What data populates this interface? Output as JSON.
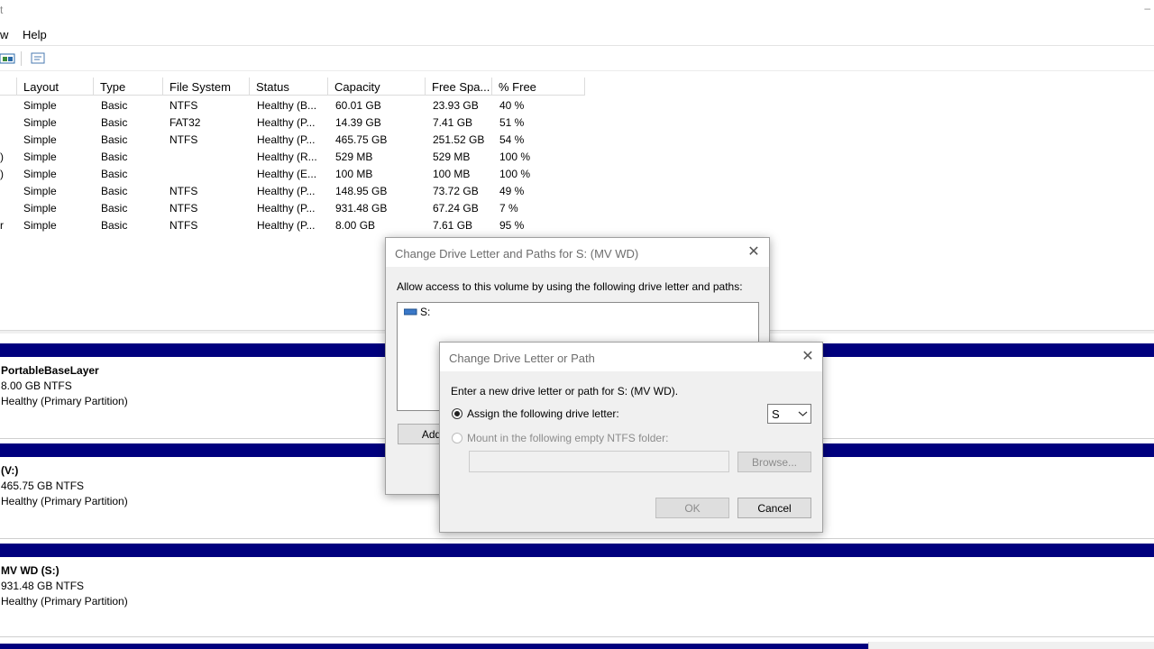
{
  "window": {
    "title_fragment": "t",
    "minimize_glyph": "–"
  },
  "menu": {
    "view_fragment": "w",
    "help": "Help"
  },
  "columns": [
    "Layout",
    "Type",
    "File System",
    "Status",
    "Capacity",
    "Free Spa...",
    "% Free"
  ],
  "volumes": [
    {
      "prefix": "",
      "layout": "Simple",
      "type": "Basic",
      "fs": "NTFS",
      "status": "Healthy (B...",
      "capacity": "60.01 GB",
      "free": "23.93 GB",
      "pct": "40 %"
    },
    {
      "prefix": "",
      "layout": "Simple",
      "type": "Basic",
      "fs": "FAT32",
      "status": "Healthy (P...",
      "capacity": "14.39 GB",
      "free": "7.41 GB",
      "pct": "51 %"
    },
    {
      "prefix": "",
      "layout": "Simple",
      "type": "Basic",
      "fs": "NTFS",
      "status": "Healthy (P...",
      "capacity": "465.75 GB",
      "free": "251.52 GB",
      "pct": "54 %"
    },
    {
      "prefix": ")",
      "layout": "Simple",
      "type": "Basic",
      "fs": "",
      "status": "Healthy (R...",
      "capacity": "529 MB",
      "free": "529 MB",
      "pct": "100 %"
    },
    {
      "prefix": ")",
      "layout": "Simple",
      "type": "Basic",
      "fs": "",
      "status": "Healthy (E...",
      "capacity": "100 MB",
      "free": "100 MB",
      "pct": "100 %"
    },
    {
      "prefix": "",
      "layout": "Simple",
      "type": "Basic",
      "fs": "NTFS",
      "status": "Healthy (P...",
      "capacity": "148.95 GB",
      "free": "73.72 GB",
      "pct": "49 %"
    },
    {
      "prefix": "",
      "layout": "Simple",
      "type": "Basic",
      "fs": "NTFS",
      "status": "Healthy (P...",
      "capacity": "931.48 GB",
      "free": "67.24 GB",
      "pct": "7 %"
    },
    {
      "prefix": "r",
      "layout": "Simple",
      "type": "Basic",
      "fs": "NTFS",
      "status": "Healthy (P...",
      "capacity": "8.00 GB",
      "free": "7.61 GB",
      "pct": "95 %"
    }
  ],
  "disks": [
    {
      "name": "PortableBaseLayer",
      "size": "8.00 GB NTFS",
      "status": "Healthy (Primary Partition)"
    },
    {
      "name": " (V:)",
      "size": "465.75 GB NTFS",
      "status": "Healthy (Primary Partition)"
    },
    {
      "name": "MV WD  (S:)",
      "size": "931.48 GB NTFS",
      "status": "Healthy (Primary Partition)"
    }
  ],
  "dialog_paths": {
    "title": "Change Drive Letter and Paths for S: (MV WD)",
    "instruction": "Allow access to this volume by using the following drive letter and paths:",
    "list_item": "S:",
    "add_button": "Add"
  },
  "dialog_change": {
    "title": "Change Drive Letter or Path",
    "instruction": "Enter a new drive letter or path for S: (MV WD).",
    "assign_label": "Assign the following drive letter:",
    "mount_label": "Mount in the following empty NTFS folder:",
    "drive_letter": "S",
    "folder_value": "",
    "browse_button": "Browse...",
    "ok_button": "OK",
    "cancel_button": "Cancel"
  },
  "colors": {
    "disk_band": "#00007e",
    "dialog_bg": "#f0f0f0"
  }
}
